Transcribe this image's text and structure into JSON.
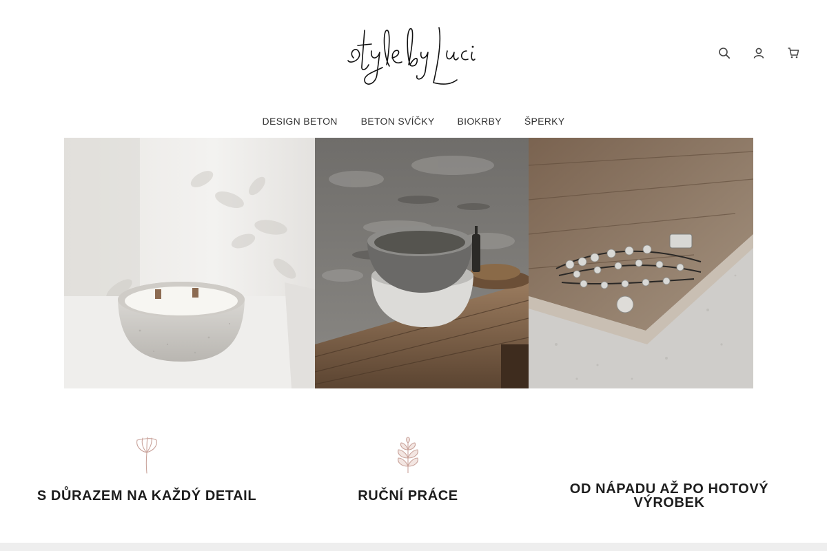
{
  "header": {
    "logo_text": "style by Luci",
    "icons": [
      "search-icon",
      "user-icon",
      "cart-icon"
    ]
  },
  "nav": {
    "items": [
      "DESIGN BETON",
      "BETON SVÍČKY",
      "BIOKRBY",
      "ŠPERKY"
    ]
  },
  "gallery": {
    "images": [
      "concrete-candle-image",
      "concrete-bowls-image",
      "silver-bracelet-image"
    ]
  },
  "features": [
    {
      "icon": "flower-icon",
      "title": "S DŮRAZEM NA KAŽDÝ DETAIL"
    },
    {
      "icon": "leaf-icon",
      "title": "RUČNÍ PRÁCE"
    },
    {
      "icon": "",
      "title": "OD NÁPADU AŽ PO HOTOVÝ VÝROBEK"
    }
  ],
  "colors": {
    "text": "#222222",
    "accent_icon": "#c9a39b",
    "footer_strip": "#eeeeee"
  }
}
